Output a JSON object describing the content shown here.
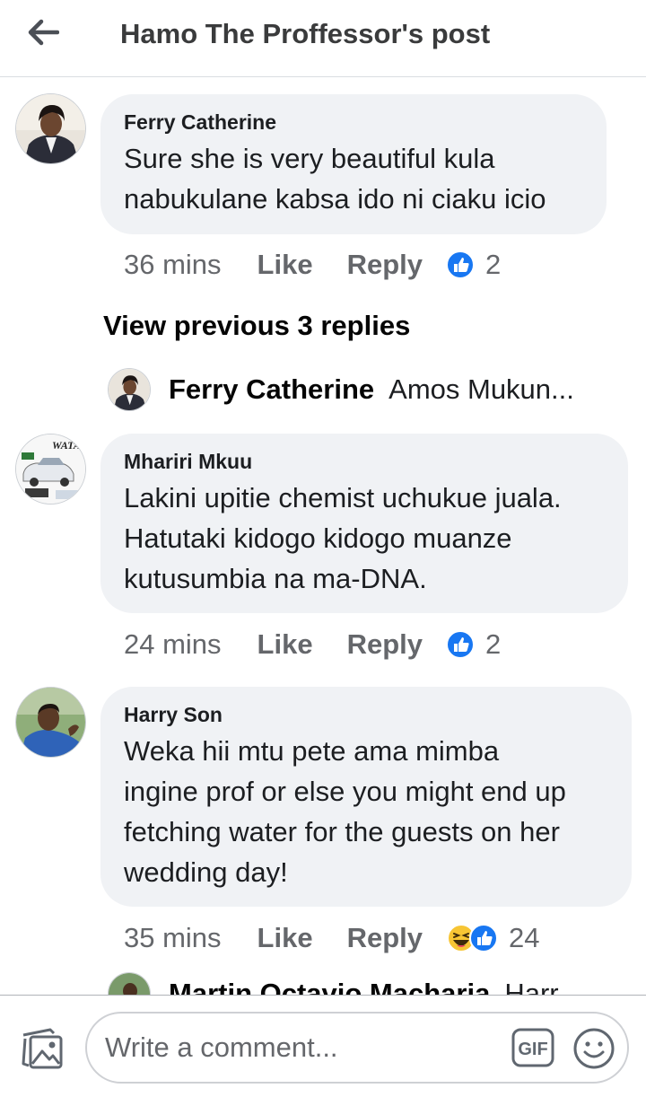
{
  "header": {
    "back_icon": "arrow-left-icon",
    "title": "Hamo The Proffessor's post"
  },
  "comments": [
    {
      "author": "Ferry Catherine",
      "lines": [
        "Sure she is very beautiful kula",
        "nabukulane kabsa ido ni ciaku icio"
      ],
      "time": "36 mins",
      "like_label": "Like",
      "reply_label": "Reply",
      "reaction_count": "2",
      "reactions": [
        "like-reaction-icon"
      ]
    },
    {
      "author": "Mhariri Mkuu",
      "avatar_text": "WATAM",
      "lines": [
        "Lakini upitie chemist uchukue juala.",
        "Hatutaki kidogo kidogo muanze",
        "kutusumbia na ma-DNA."
      ],
      "time": "24 mins",
      "like_label": "Like",
      "reply_label": "Reply",
      "reaction_count": "2",
      "reactions": [
        "like-reaction-icon"
      ]
    },
    {
      "author": "Harry Son",
      "lines": [
        "Weka hii mtu pete ama mimba",
        "ingine prof or else you might end up",
        "fetching water for the guests on her",
        "wedding day!"
      ],
      "time": "35 mins",
      "like_label": "Like",
      "reply_label": "Reply",
      "reaction_count": "24",
      "reactions": [
        "haha-reaction-icon",
        "like-reaction-icon"
      ]
    }
  ],
  "view_previous": "View previous 3 replies",
  "reply_preview": {
    "author": "Ferry Catherine",
    "text": "Amos Mukun..."
  },
  "partial_reply": {
    "author": "Martin Octavio Macharia",
    "text": "Harr"
  },
  "footer": {
    "photo_icon": "photo-icon",
    "placeholder": "Write a comment...",
    "gif_label": "GIF",
    "emoji_icon": "smiley-icon"
  },
  "colors": {
    "bubble": "#f0f2f5",
    "like_blue": "#1877f2",
    "muted": "#65676b"
  }
}
